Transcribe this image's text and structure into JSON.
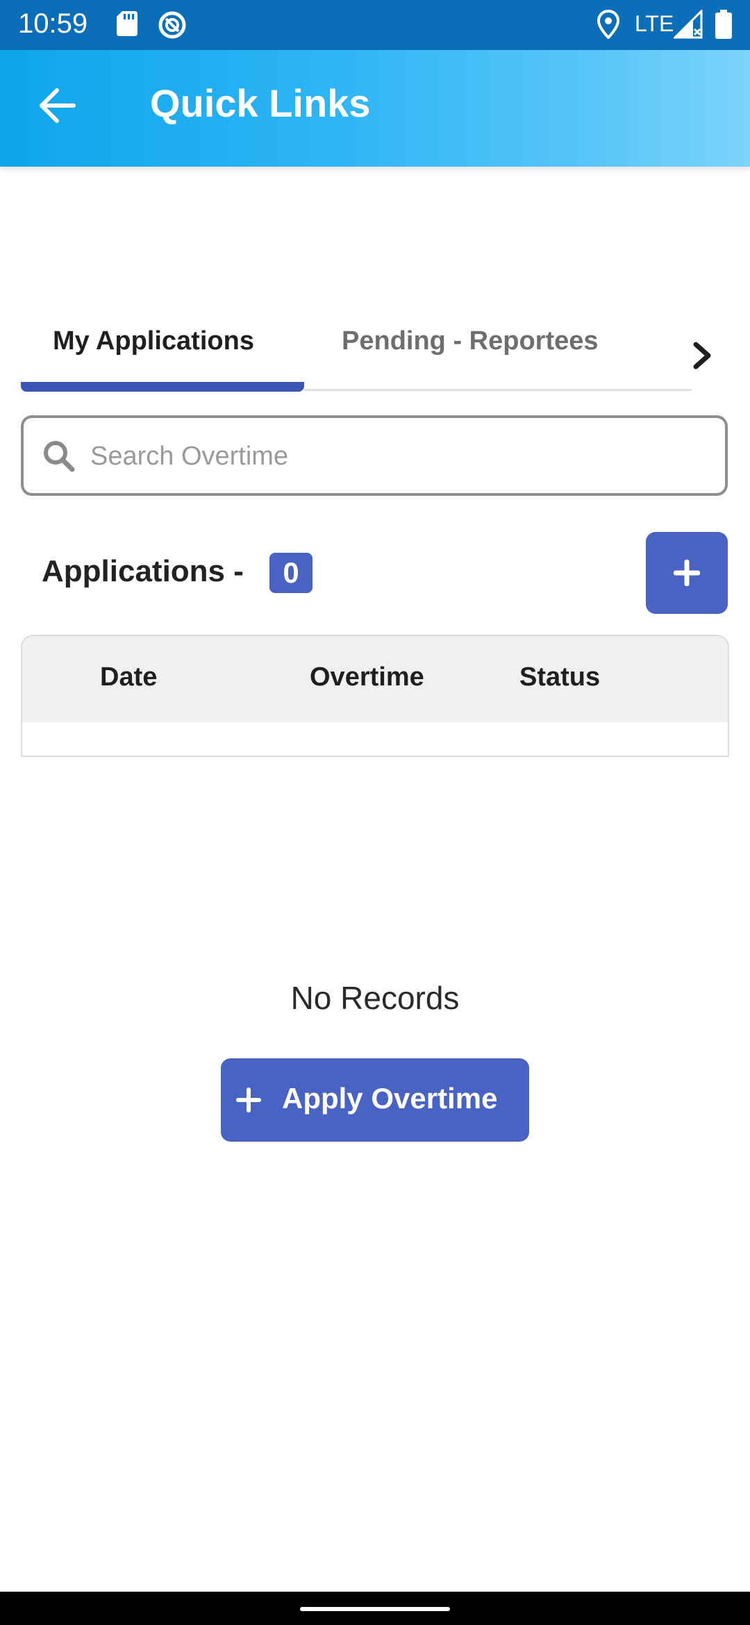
{
  "status_bar": {
    "time": "10:59",
    "network": "LTE",
    "icons": [
      "sd-card-icon",
      "data-saver-icon",
      "location-icon",
      "signal-icon",
      "battery-icon"
    ]
  },
  "app_bar": {
    "title": "Quick Links",
    "back_icon": "arrow-left-icon",
    "gradient": [
      "#0ea5ec",
      "#7cd3fb"
    ]
  },
  "tabs": [
    {
      "label": "My Applications",
      "selected": true
    },
    {
      "label": "Pending - Reportees",
      "selected": false
    }
  ],
  "search": {
    "placeholder": "Search Overtime",
    "value": ""
  },
  "applications": {
    "heading": "Applications -",
    "count": "0"
  },
  "table": {
    "columns": [
      "Date",
      "Overtime",
      "Status"
    ],
    "rows": []
  },
  "empty_state": {
    "message": "No Records",
    "button_label": "Apply Overtime"
  },
  "colors": {
    "accent": "#4863c4",
    "tab_indicator": "#3a55b4",
    "status_bar": "#0a6fb8"
  }
}
